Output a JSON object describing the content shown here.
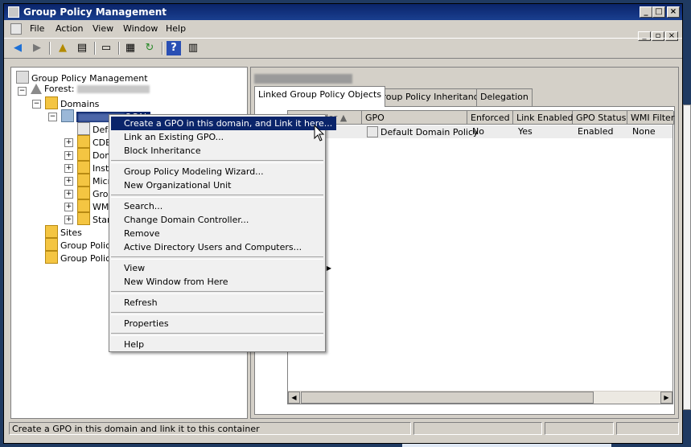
{
  "window": {
    "title": "Group Policy Management"
  },
  "menu": [
    "File",
    "Action",
    "View",
    "Window",
    "Help"
  ],
  "tree": {
    "root": "Group Policy Management",
    "forest_label": "Forest:",
    "domains": "Domains",
    "domain_suffix": "OCAL",
    "children": [
      "Defa",
      "CDBi",
      "Dom",
      "Insta",
      "Micro",
      "Grou",
      "WMI",
      "Start"
    ],
    "sites": "Sites",
    "gp_a": "Group Policy",
    "gp_b": "Group Policy"
  },
  "tabs": [
    "Linked Group Policy Objects",
    "Group Policy Inheritance",
    "Delegation"
  ],
  "columns": [
    "Link Order",
    "GPO",
    "Enforced",
    "Link Enabled",
    "GPO Status",
    "WMI Filter"
  ],
  "rows": [
    {
      "gpo": "Default Domain Policy",
      "enforced": "No",
      "link_enabled": "Yes",
      "status": "Enabled",
      "wmi": "None"
    }
  ],
  "context_menu": {
    "create_gpo": "Create a GPO in this domain, and Link it here...",
    "link_existing": "Link an Existing GPO...",
    "block_inheritance": "Block Inheritance",
    "modeling_wizard": "Group Policy Modeling Wizard...",
    "new_ou": "New Organizational Unit",
    "search": "Search...",
    "change_dc": "Change Domain Controller...",
    "remove": "Remove",
    "ad_users": "Active Directory Users and Computers...",
    "view": "View",
    "new_window": "New Window from Here",
    "refresh": "Refresh",
    "properties": "Properties",
    "help": "Help"
  },
  "status": "Create a GPO in this domain and link it to this container",
  "colors": {
    "title_bar": "#0a246a",
    "highlight": "#0a246a",
    "chrome": "#d4d0c8"
  },
  "icons": [
    "back-icon",
    "forward-icon",
    "up-icon",
    "show-hide-tree-icon",
    "copy-icon",
    "properties-icon",
    "refresh-icon",
    "help-icon",
    "console-icon"
  ]
}
